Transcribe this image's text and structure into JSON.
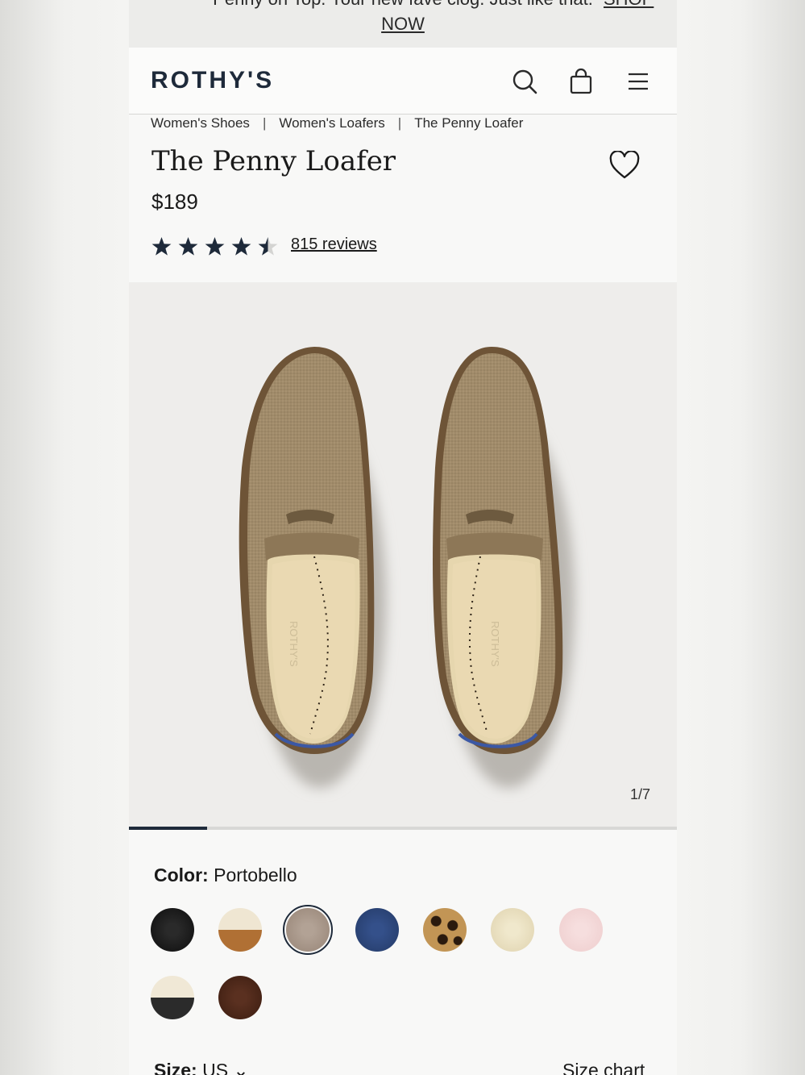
{
  "promo": {
    "line1": "Penny on Top. Your new fave clog. Just like that.",
    "shop": "SHOP",
    "line2": "NOW"
  },
  "header": {
    "logo": "ROTHY'S",
    "icons": [
      "search-icon",
      "bag-icon",
      "menu-icon"
    ]
  },
  "breadcrumb": [
    "Women's Shoes",
    "Women's Loafers",
    "The Penny Loafer"
  ],
  "product": {
    "title": "The Penny Loafer",
    "price": "$189",
    "rating": 4.5,
    "rating_max": 5,
    "reviews": "815 reviews"
  },
  "gallery": {
    "counter": "1/7",
    "progress": 0.142
  },
  "color": {
    "label": "Color:",
    "selected": "Portobello",
    "swatches": [
      {
        "name": "black",
        "color": "#1d1d1d"
      },
      {
        "name": "cream-cognac",
        "color": "#b97a3e"
      },
      {
        "name": "portobello",
        "color": "#a8978a",
        "selected": true
      },
      {
        "name": "navy",
        "color": "#2c4272"
      },
      {
        "name": "leopard",
        "color": "#b78a4a"
      },
      {
        "name": "ivory",
        "color": "#e9dfbf"
      },
      {
        "name": "blush",
        "color": "#f1d3d3"
      },
      {
        "name": "cream-black",
        "color": "#2f2f2f"
      },
      {
        "name": "espresso",
        "color": "#4a2717"
      }
    ]
  },
  "size": {
    "label": "Size:",
    "value": "US",
    "size_chart": "Size chart"
  },
  "colors": {
    "brand": "#1e2a3a",
    "background": "#f8f8f7"
  }
}
